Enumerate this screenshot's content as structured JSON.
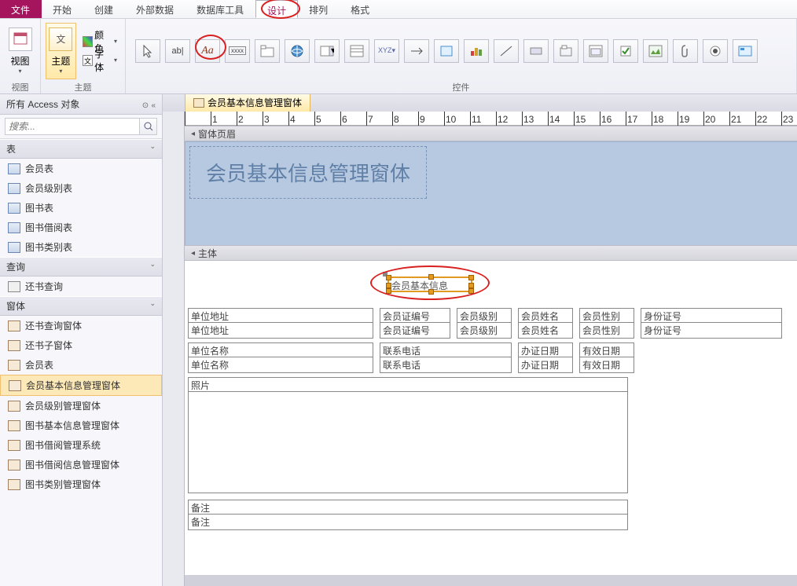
{
  "menu": {
    "file": "文件",
    "tabs": [
      "开始",
      "创建",
      "外部数据",
      "数据库工具",
      "设计",
      "排列",
      "格式"
    ],
    "active": "设计"
  },
  "ribbon": {
    "view_group": "视图",
    "view_btn": "视图",
    "theme_group": "主题",
    "theme_btn": "主题",
    "colors": "颜色",
    "fonts": "字体",
    "controls_group": "控件"
  },
  "nav": {
    "title": "所有 Access 对象",
    "search_placeholder": "搜索...",
    "cat_tables": "表",
    "tables": [
      "会员表",
      "会员级别表",
      "图书表",
      "图书借阅表",
      "图书类别表"
    ],
    "cat_queries": "查询",
    "queries": [
      "还书查询"
    ],
    "cat_forms": "窗体",
    "forms": [
      "还书查询窗体",
      "还书子窗体",
      "会员表",
      "会员基本信息管理窗体",
      "会员级别管理窗体",
      "图书基本信息管理窗体",
      "图书借阅管理系统",
      "图书借阅信息管理窗体",
      "图书类别管理窗体"
    ],
    "selected_form": "会员基本信息管理窗体"
  },
  "document": {
    "tab_title": "会员基本信息管理窗体",
    "section_header": "窗体页眉",
    "section_detail": "主体",
    "form_title": "会员基本信息管理窗体",
    "selected_label": "会员基本信息",
    "fields_row1_labels": [
      "单位地址",
      "会员证编号",
      "会员级别",
      "会员姓名",
      "会员性别",
      "身份证号"
    ],
    "fields_row1_ctrls": [
      "单位地址",
      "会员证编号",
      "会员级别",
      "会员姓名",
      "会员性别",
      "身份证号"
    ],
    "fields_row2_labels": [
      "单位名称",
      "联系电话",
      "办证日期",
      "有效日期"
    ],
    "fields_row2_ctrls": [
      "单位名称",
      "联系电话",
      "办证日期",
      "有效日期"
    ],
    "photo_label": "照片",
    "remark_label": "备注",
    "remark_ctrl": "备注"
  }
}
